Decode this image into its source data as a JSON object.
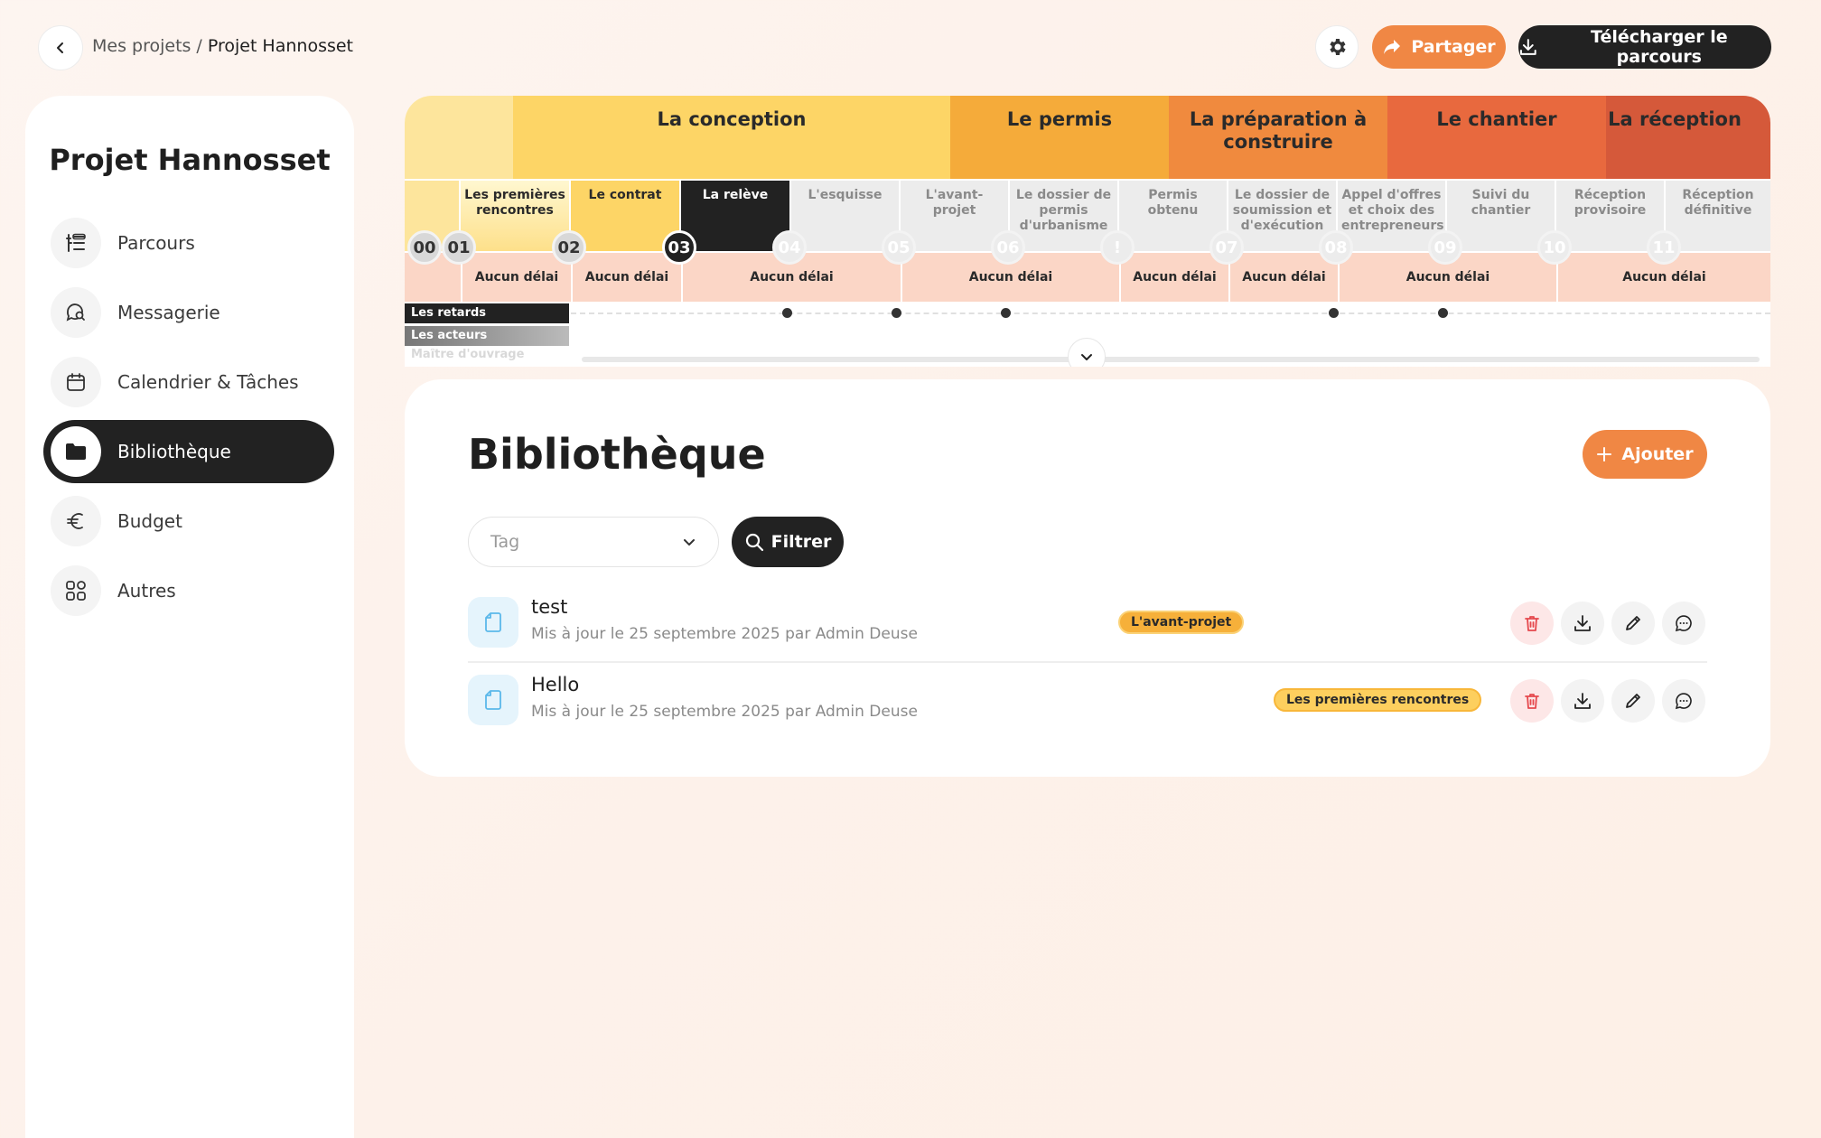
{
  "header": {
    "breadcrumb_root": "Mes projets",
    "breadcrumb_sep": "/",
    "breadcrumb_current": "Projet Hannosset",
    "share_label": "Partager",
    "download_label": "Télécharger le parcours"
  },
  "sidebar": {
    "project_title": "Projet Hannosset",
    "items": [
      {
        "label": "Parcours",
        "icon": "journey-icon",
        "active": false
      },
      {
        "label": "Messagerie",
        "icon": "chat-search-icon",
        "active": false
      },
      {
        "label": "Calendrier & Tâches",
        "icon": "calendar-icon",
        "active": false
      },
      {
        "label": "Bibliothèque",
        "icon": "folder-icon",
        "active": true
      },
      {
        "label": "Budget",
        "icon": "euro-icon",
        "active": false
      },
      {
        "label": "Autres",
        "icon": "apps-grid-icon",
        "active": false
      }
    ]
  },
  "timeline": {
    "phases": [
      {
        "label": "La conception",
        "color": "#fdd566"
      },
      {
        "label": "Le permis",
        "color": "#f5ab3a"
      },
      {
        "label": "La préparation à construire",
        "color": "#f08a3e"
      },
      {
        "label": "Le chantier",
        "color": "#e8693e"
      },
      {
        "label": "La réception",
        "color": "#d5593a"
      }
    ],
    "steps": [
      {
        "label": "Les premières rencontres",
        "num": "01"
      },
      {
        "label": "Le contrat",
        "num": "02"
      },
      {
        "label": "La relève",
        "num": "03"
      },
      {
        "label": "L'esquisse",
        "num": "04"
      },
      {
        "label": "L'avant-projet",
        "num": "05"
      },
      {
        "label": "Le dossier de permis d'urbanisme",
        "num": "06"
      },
      {
        "label": "Permis obtenu",
        "num": "!"
      },
      {
        "label": "Le dossier de soumission et d'exécution",
        "num": "07"
      },
      {
        "label": "Appel d'offres et choix des entrepreneurs",
        "num": "08"
      },
      {
        "label": "Suivi du chantier",
        "num": "09"
      },
      {
        "label": "Réception provisoire",
        "num": "10"
      },
      {
        "label": "Réception définitive",
        "num": "11"
      }
    ],
    "start_num": "00",
    "delay_label": "Aucun délai",
    "rows": [
      "Les retards",
      "Les acteurs",
      "Maître d'ouvrage"
    ]
  },
  "library": {
    "title": "Bibliothèque",
    "add_label": "Ajouter",
    "tag_placeholder": "Tag",
    "filter_label": "Filtrer",
    "files": [
      {
        "name": "test",
        "meta": "Mis à jour le 25 septembre 2025 par Admin Deuse",
        "tag": "L'avant-projet"
      },
      {
        "name": "Hello",
        "meta": "Mis à jour le 25 septembre 2025 par Admin Deuse",
        "tag": "Les premières rencontres"
      }
    ]
  }
}
